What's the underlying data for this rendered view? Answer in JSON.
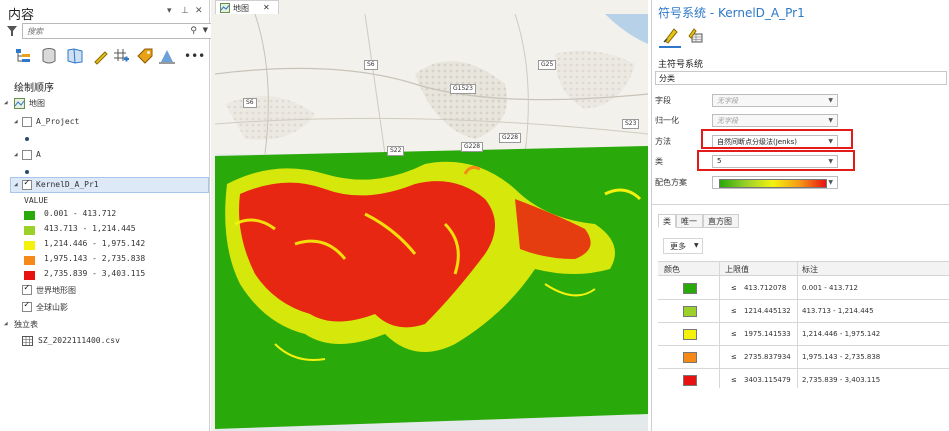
{
  "contents": {
    "title": "内容",
    "search_placeholder": "搜索",
    "section_title": "绘制顺序",
    "layers": {
      "map": "地图",
      "a_project": "A_Project",
      "a": "A",
      "kernel": "KernelD_A_Pr1",
      "field": "VALUE",
      "classes": [
        {
          "label": "0.001 - 413.712",
          "color": "#2aa90a"
        },
        {
          "label": "413.713 - 1,214.445",
          "color": "#9bd12a"
        },
        {
          "label": "1,214.446 - 1,975.142",
          "color": "#f4f20d"
        },
        {
          "label": "1,975.143 - 2,735.838",
          "color": "#f58a16"
        },
        {
          "label": "2,735.839 - 3,403.115",
          "color": "#e91212"
        }
      ],
      "topo": "世界地形图",
      "hillshade": "全球山影",
      "standalone_tables": "独立表",
      "csv": "SZ_2022111400.csv"
    }
  },
  "map": {
    "tab": "地图",
    "road_labels": [
      "S6",
      "G25",
      "G1523",
      "S6",
      "S23",
      "G228",
      "G228",
      "S22"
    ]
  },
  "symbology": {
    "title": "符号系统 - KernelD_A_Pr1",
    "primary": "主符号系统",
    "type_value": "分类",
    "field_label": "字段",
    "field_value": "无字段",
    "normalize_label": "归一化",
    "normalize_value": "无字段",
    "method_label": "方法",
    "method_value": "自然间断点分级法(Jenks)",
    "classes_label": "类",
    "classes_value": "5",
    "ramp_label": "配色方案",
    "tabs": [
      "类",
      "唯一",
      "直方图"
    ],
    "more": "更多",
    "table_headers": [
      "颜色",
      "上限值",
      "标注"
    ],
    "rows": [
      {
        "color": "#2aa90a",
        "le": "≤",
        "upper": "413.712078",
        "label": "0.001 - 413.712"
      },
      {
        "color": "#9bd12a",
        "le": "≤",
        "upper": "1214.445132",
        "label": "413.713 - 1,214.445"
      },
      {
        "color": "#f4f20d",
        "le": "≤",
        "upper": "1975.141533",
        "label": "1,214.446 - 1,975.142"
      },
      {
        "color": "#f58a16",
        "le": "≤",
        "upper": "2735.837934",
        "label": "1,975.143 - 2,735.838"
      },
      {
        "color": "#e91212",
        "le": "≤",
        "upper": "3403.115479",
        "label": "2,735.839 - 3,403.115"
      }
    ]
  },
  "colors": {
    "accent": "#2d78c8",
    "highlight_box": "#e21b1b",
    "raster_green": "#2aa90a"
  }
}
